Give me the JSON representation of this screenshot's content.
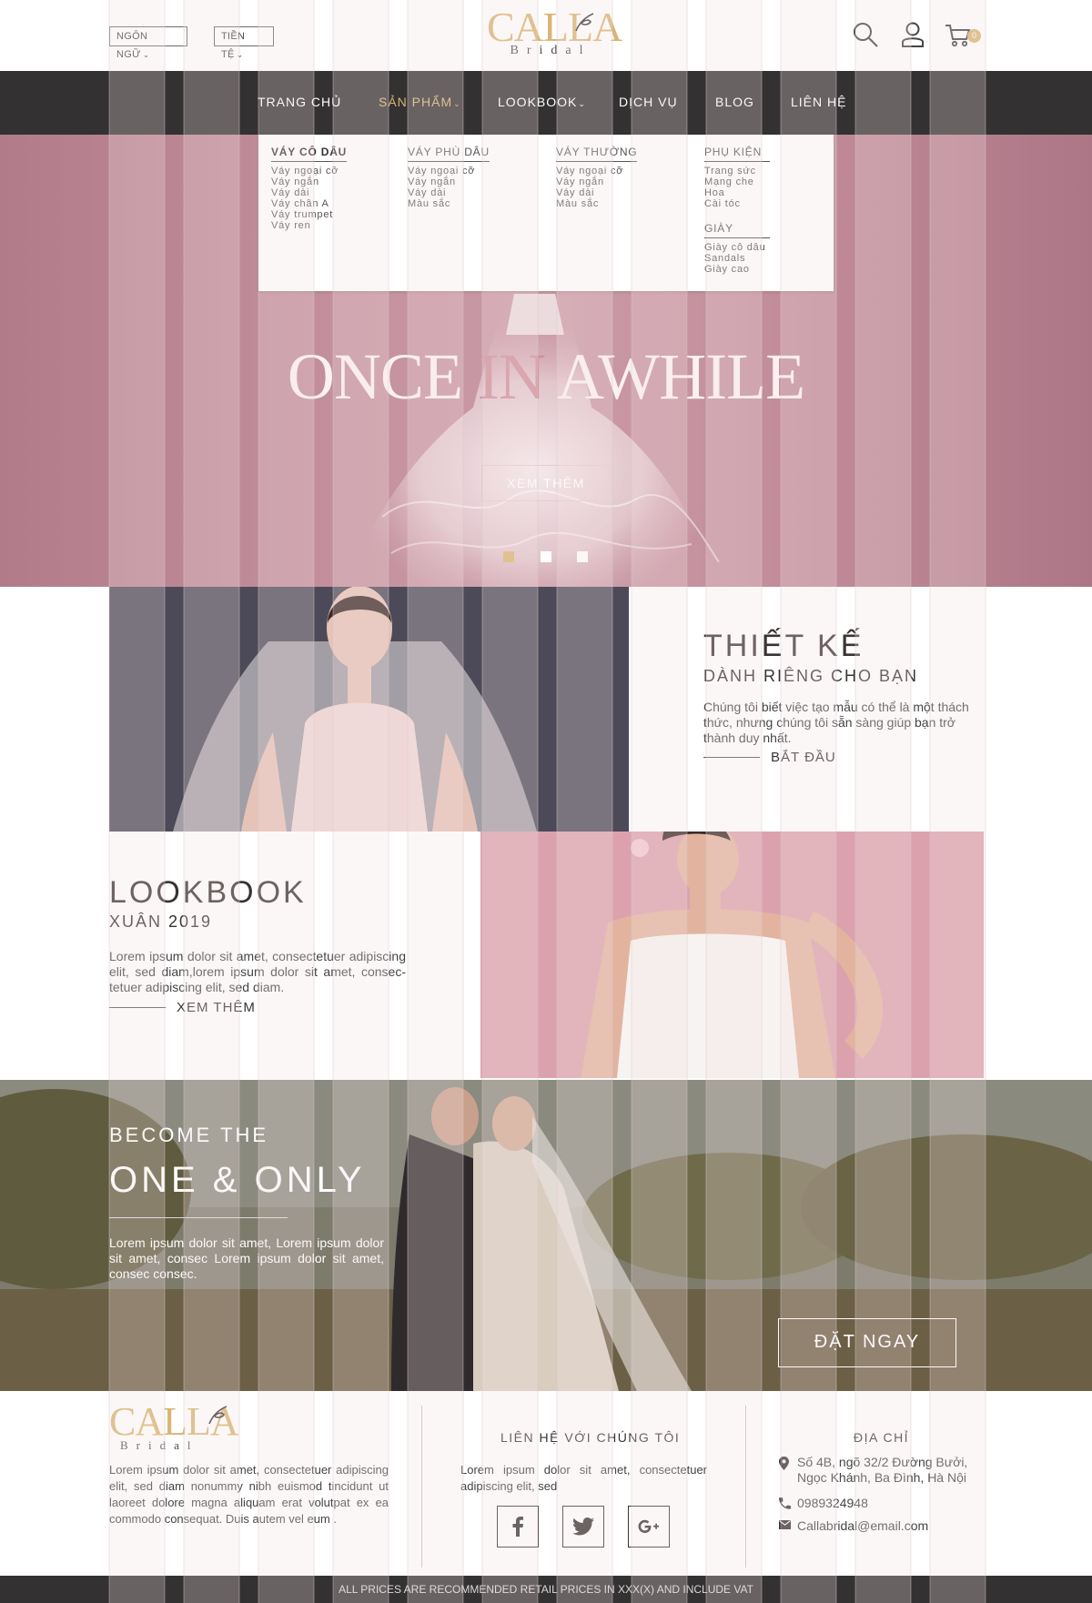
{
  "header": {
    "language_label": "NGÔN NGỮ",
    "currency_label": "TIỀN TỆ",
    "logo_text": "CALLA",
    "logo_sub": "Bridal",
    "cart_count": "0",
    "icons": [
      "search-icon",
      "user-icon",
      "cart-icon"
    ]
  },
  "nav": {
    "items": [
      {
        "label": "TRANG CHỦ"
      },
      {
        "label": "SẢN PHẨM"
      },
      {
        "label": "LOOKBOOK"
      },
      {
        "label": "DỊCH VỤ"
      },
      {
        "label": "BLOG"
      },
      {
        "label": "LIÊN HỆ"
      }
    ],
    "active_index": 1,
    "accent_color": "#d9b472"
  },
  "mega_menu": {
    "columns": [
      {
        "title": "VÁY CÔ DÂU",
        "links": [
          "Váy ngoại cỡ",
          "Váy ngắn",
          "Váy dài",
          "Váy chân A",
          "Váy trumpet",
          "Váy ren"
        ]
      },
      {
        "title": "VÁY PHÙ DÂU",
        "links": [
          "Váy ngoại cỡ",
          "Váy ngắn",
          "Váy dài",
          "Màu sắc"
        ]
      },
      {
        "title": "VÁY THƯỜNG",
        "links": [
          "Váy ngoại cỡ",
          "Váy ngắn",
          "Váy dài",
          "Màu sắc"
        ]
      },
      {
        "title": "PHỤ KIỆN",
        "links": [
          "Trang sức",
          "Mạng che",
          "Hoa",
          "Cài tóc"
        ]
      },
      {
        "title": "GIÀY",
        "links": [
          "Giày cô dâu",
          "Sandals",
          "Giày cao"
        ]
      }
    ]
  },
  "hero": {
    "title_part1": "ONCE ",
    "title_part2": "IN",
    "title_part3": " AWHILE",
    "button": "XEM THÊM",
    "slides": 3,
    "active_slide": 0
  },
  "design": {
    "title": "THIẾT KẾ",
    "subtitle": "DÀNH RIÊNG CHO BẠN",
    "text": "Chúng tôi biết việc tạo mẫu có thể là một thách thức, nhưng chúng tôi sẵn sàng giúp bạn trở thành duy nhất.",
    "link": "BẮT ĐẦU"
  },
  "lookbook": {
    "title": "LOOKBOOK",
    "subtitle": "XUÂN 2019",
    "text": "Lorem ipsum dolor sit amet, consectetuer adipiscing elit, sed diam,lorem ipsum dolor sit amet, consec-tetuer adipiscing elit, sed diam.",
    "link": "XEM THÊM"
  },
  "one_only": {
    "kicker": "BECOME THE",
    "title": "ONE & ONLY",
    "text": "Lorem ipsum dolor sit amet, Lorem ipsum dolor sit amet, consec Lorem ipsum dolor sit amet, consec consec.",
    "button": "ĐẶT NGAY"
  },
  "footer": {
    "about": "Lorem ipsum dolor sit amet, consectetuer adipiscing elit, sed diam nonummy nibh euismod tincidunt ut laoreet dolore magna aliquam erat volutpat ex ea commodo consequat. Duis autem vel eum .",
    "contact_title": "LIÊN HỆ VỚI CHÚNG TÔI",
    "contact_text": "Lorem ipsum dolor sit amet, consectetuer adipiscing elit, sed",
    "social": [
      "facebook-icon",
      "twitter-icon",
      "google-plus-icon"
    ],
    "address_title": "ĐỊA CHỈ",
    "address": "Số 4B, ngõ 32/2 Đường Bưởi, Ngọc Khánh, Ba Đình, Hà Nội",
    "phone": "0989324948",
    "email": "Callabridal@email.com",
    "bottom_note": "ALL PRICES ARE RECOMMENDED RETAIL PRICES IN XXX(X) AND INCLUDE VAT"
  },
  "colors": {
    "gold": "#d9b472",
    "dark": "#333132",
    "hero_pink": "#c38f9d",
    "grid_tint": "#f3e3e3"
  }
}
